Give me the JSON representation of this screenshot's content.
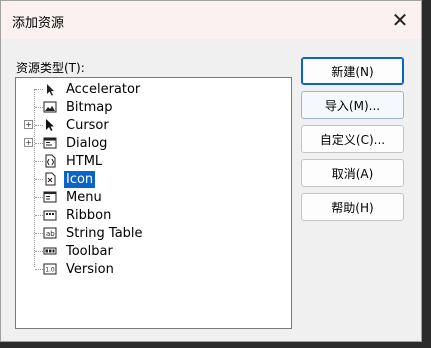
{
  "dialog": {
    "title": "添加资源",
    "close_glyph": "✕",
    "types_label": "资源类型(T):"
  },
  "tree": {
    "items": [
      {
        "label": "Accelerator",
        "icon": "accelerator-icon",
        "expandable": false,
        "selected": false
      },
      {
        "label": "Bitmap",
        "icon": "bitmap-icon",
        "expandable": false,
        "selected": false
      },
      {
        "label": "Cursor",
        "icon": "cursor-icon",
        "expandable": true,
        "selected": false
      },
      {
        "label": "Dialog",
        "icon": "dialog-icon",
        "expandable": true,
        "selected": false
      },
      {
        "label": "HTML",
        "icon": "html-icon",
        "expandable": false,
        "selected": false
      },
      {
        "label": "Icon",
        "icon": "icon-resource-icon",
        "expandable": false,
        "selected": true
      },
      {
        "label": "Menu",
        "icon": "menu-icon",
        "expandable": false,
        "selected": false
      },
      {
        "label": "Ribbon",
        "icon": "ribbon-icon",
        "expandable": false,
        "selected": false
      },
      {
        "label": "String Table",
        "icon": "string-table-icon",
        "expandable": false,
        "selected": false
      },
      {
        "label": "Toolbar",
        "icon": "toolbar-icon",
        "expandable": false,
        "selected": false
      },
      {
        "label": "Version",
        "icon": "version-icon",
        "expandable": false,
        "selected": false
      }
    ],
    "expander_glyph": "+",
    "version_icon_text": "1.0",
    "string_table_icon_text": "ab"
  },
  "buttons": {
    "new": "新建(N)",
    "import": "导入(M)...",
    "custom": "自定义(C)...",
    "cancel": "取消(A)",
    "help": "帮助(H)"
  },
  "colors": {
    "selection": "#0a64c8",
    "titlebar": "#fbf1f1",
    "dialog_bg": "#f0f0f0"
  }
}
